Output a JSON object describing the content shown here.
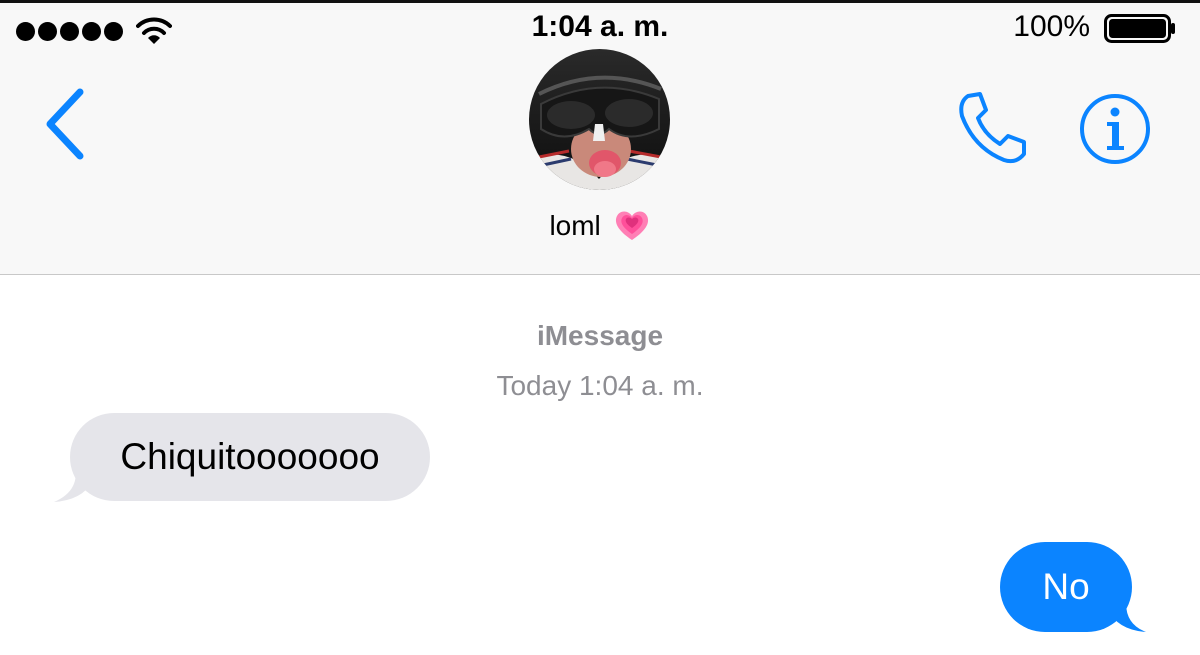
{
  "status_bar": {
    "time": "1:04 a. m.",
    "battery_percent": "100%",
    "signal_bars": 5,
    "battery_level": 1.0
  },
  "nav": {
    "back_icon": "chevron-left-icon",
    "call_icon": "phone-icon",
    "info_icon": "info-icon",
    "accent_color": "#0b84ff"
  },
  "contact": {
    "name": "loml",
    "emoji_icon": "growing-heart-icon"
  },
  "conversation": {
    "service": "iMessage",
    "timestamp": "Today 1:04 a. m.",
    "messages": [
      {
        "direction": "incoming",
        "text": "Chiquitooooooo"
      },
      {
        "direction": "outgoing",
        "text": "No"
      }
    ],
    "incoming_color": "#e5e5ea",
    "outgoing_color": "#0b84ff"
  }
}
